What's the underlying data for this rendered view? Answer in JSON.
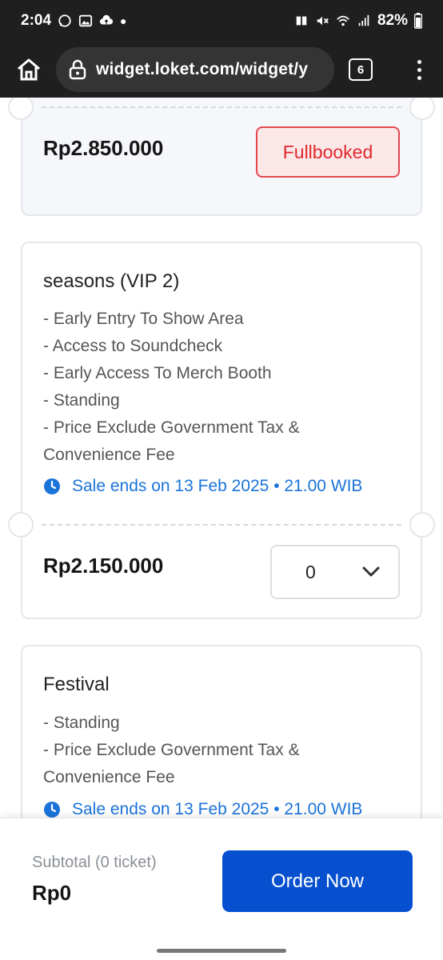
{
  "status_bar": {
    "time": "2:04",
    "battery": "82%"
  },
  "browser": {
    "url": "widget.loket.com/widget/y",
    "tab_count": "6"
  },
  "tickets": [
    {
      "price": "Rp2.850.000",
      "status_label": "Fullbooked"
    },
    {
      "name": "seasons (VIP 2)",
      "description": [
        "- Early Entry To Show Area",
        "- Access to Soundcheck",
        "- Early Access To Merch Booth",
        "- Standing",
        "- Price Exclude Government Tax &",
        "Convenience Fee"
      ],
      "sale_end": "Sale ends on 13 Feb 2025 • 21.00 WIB",
      "price": "Rp2.150.000",
      "quantity": "0"
    },
    {
      "name": "Festival",
      "description": [
        "- Standing",
        "- Price Exclude Government Tax &",
        "Convenience Fee"
      ],
      "sale_end": "Sale ends on 13 Feb 2025 • 21.00 WIB"
    }
  ],
  "footer": {
    "subtotal_label": "Subtotal (0 ticket)",
    "subtotal_value": "Rp0",
    "order_button": "Order Now"
  },
  "colors": {
    "accent": "#0650d0",
    "link": "#1a73d9",
    "fullbooked_border": "#e5484d",
    "fullbooked_bg": "#fde8e8"
  }
}
